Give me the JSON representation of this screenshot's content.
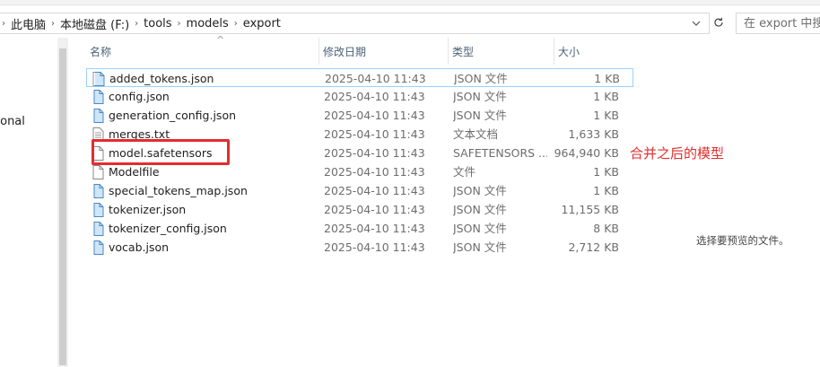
{
  "address": {
    "breadcrumb": [
      "此电脑",
      "本地磁盘 (F:)",
      "tools",
      "models",
      "export"
    ],
    "search_placeholder": "在 export 中搜"
  },
  "navpane": {
    "visible_label": "rsonal"
  },
  "columns": {
    "name": "名称",
    "date": "修改日期",
    "type": "类型",
    "size": "大小"
  },
  "files": [
    {
      "name": "added_tokens.json",
      "date": "2025-04-10 11:43",
      "type": "JSON 文件",
      "size": "1 KB",
      "icon": "json-file-icon"
    },
    {
      "name": "config.json",
      "date": "2025-04-10 11:43",
      "type": "JSON 文件",
      "size": "1 KB",
      "icon": "json-file-icon"
    },
    {
      "name": "generation_config.json",
      "date": "2025-04-10 11:43",
      "type": "JSON 文件",
      "size": "1 KB",
      "icon": "json-file-icon"
    },
    {
      "name": "merges.txt",
      "date": "2025-04-10 11:43",
      "type": "文本文档",
      "size": "1,633 KB",
      "icon": "text-file-icon"
    },
    {
      "name": "model.safetensors",
      "date": "2025-04-10 11:43",
      "type": "SAFETENSORS ...",
      "size": "964,940 KB",
      "icon": "blank-file-icon"
    },
    {
      "name": "Modelfile",
      "date": "2025-04-10 11:43",
      "type": "文件",
      "size": "1 KB",
      "icon": "blank-file-icon"
    },
    {
      "name": "special_tokens_map.json",
      "date": "2025-04-10 11:43",
      "type": "JSON 文件",
      "size": "1 KB",
      "icon": "json-file-icon"
    },
    {
      "name": "tokenizer.json",
      "date": "2025-04-10 11:43",
      "type": "JSON 文件",
      "size": "11,155 KB",
      "icon": "json-file-icon"
    },
    {
      "name": "tokenizer_config.json",
      "date": "2025-04-10 11:43",
      "type": "JSON 文件",
      "size": "8 KB",
      "icon": "json-file-icon"
    },
    {
      "name": "vocab.json",
      "date": "2025-04-10 11:43",
      "type": "JSON 文件",
      "size": "2,712 KB",
      "icon": "json-file-icon"
    }
  ],
  "annotation": {
    "text": "合并之后的模型",
    "color": "#e22d2d"
  },
  "preview_pane": {
    "text": "选择要预览的文件。"
  }
}
